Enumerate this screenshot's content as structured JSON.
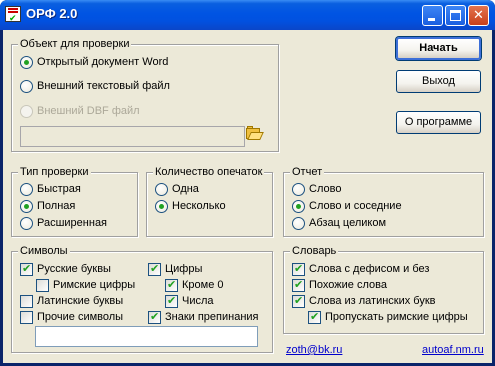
{
  "window": {
    "title": "ОРФ 2.0"
  },
  "object_group": {
    "title": "Объект для проверки",
    "options": [
      {
        "label": "Открытый документ Word",
        "selected": true,
        "disabled": false
      },
      {
        "label": "Внешний текстовый файл",
        "selected": false,
        "disabled": false
      },
      {
        "label": "Внешний DBF файл",
        "selected": false,
        "disabled": true
      }
    ],
    "path_value": ""
  },
  "buttons": {
    "start": "Начать",
    "exit": "Выход",
    "about": "О программе"
  },
  "check_type": {
    "title": "Тип проверки",
    "options": [
      {
        "label": "Быстрая",
        "selected": false
      },
      {
        "label": "Полная",
        "selected": true
      },
      {
        "label": "Расширенная",
        "selected": false
      }
    ]
  },
  "typo_count": {
    "title": "Количество опечаток",
    "options": [
      {
        "label": "Одна",
        "selected": false
      },
      {
        "label": "Несколько",
        "selected": true
      }
    ]
  },
  "report": {
    "title": "Отчет",
    "options": [
      {
        "label": "Слово",
        "selected": false
      },
      {
        "label": "Слово и соседние",
        "selected": true
      },
      {
        "label": "Абзац целиком",
        "selected": false
      }
    ]
  },
  "symbols": {
    "title": "Символы",
    "russian": {
      "label": "Русские буквы",
      "checked": true
    },
    "roman": {
      "label": "Римские цифры",
      "checked": false
    },
    "latin": {
      "label": "Латинские буквы",
      "checked": false
    },
    "other": {
      "label": "Прочие символы",
      "checked": false
    },
    "digits": {
      "label": "Цифры",
      "checked": true
    },
    "except_zero": {
      "label": "Кроме 0",
      "checked": true
    },
    "numbers": {
      "label": "Числа",
      "checked": true
    },
    "punctuation": {
      "label": "Знаки препинания",
      "checked": true
    },
    "other_value": ""
  },
  "dictionary": {
    "title": "Словарь",
    "hyphen": {
      "label": "Слова с дефисом и без",
      "checked": true
    },
    "similar": {
      "label": "Похожие слова",
      "checked": true
    },
    "latin_words": {
      "label": "Слова из латинских букв",
      "checked": true
    },
    "skip_roman": {
      "label": "Пропускать римские цифры",
      "checked": true
    }
  },
  "links": {
    "email": "zoth@bk.ru",
    "site": "autoaf.nm.ru"
  },
  "colors": {
    "title_bar": "#0054e3",
    "dialog_bg": "#ece9d8",
    "link": "#0000cc",
    "radio_dot": "#21a121"
  }
}
